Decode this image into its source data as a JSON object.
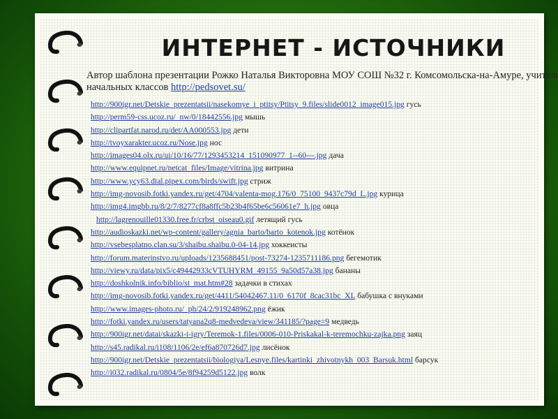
{
  "title": "ИНТЕРНЕТ - ИСТОЧНИКИ",
  "author": {
    "text": "Автор шаблона презентации Рожко Наталья Викторовна МОУ СОШ №32 г. Комсомольска-на-Амуре, учитель начальных классов",
    "link": "http://pedsovet.su/"
  },
  "sources": [
    {
      "url": "http://900igr.net/Detskie_prezentatsii/nasekomye_i_ptitsy/Ptitsy_9.files/slide0012_image015.jpg",
      "label": "гусь"
    },
    {
      "url": "http://perm59-css.ucoz.ru/_nw/0/18442556.jpg",
      "label": "мышь"
    },
    {
      "url": "http://clipartfat.narod.ru/det/AA000553.jpg",
      "label": "дети"
    },
    {
      "url": "http://tvoyxarakter.ucoz.ru/Nose.jpg",
      "label": "нос"
    },
    {
      "url": "http://images04.olx.ru/ui/10/16/77/1293453214_151090977_1--60---.jpg",
      "label": "дача"
    },
    {
      "url": "http://www.equipnet.ru/netcat_files/Image/vitrina.jpg",
      "label": "витрина"
    },
    {
      "url": "http://www.ycy63.dial.pipex.com/birds/swift.jpg",
      "label": "стриж"
    },
    {
      "url": "http://img-novosib.fotki.yandex.ru/get/4704/valenta-mog.176/0_75100_9437c79d_L.jpg",
      "label": "курица"
    },
    {
      "url": "http://img4.imgbb.ru/8/2/7/8277cf8a8ffc5b23b4f65be6c56061e7_h.jpg",
      "label": "овца"
    },
    {
      "url": "http://lagrenouille01330.free.fr/crbst_oiseau0.gif",
      "label": "летящий гусь"
    },
    {
      "url": "http://audioskazki.net/wp-content/gallery/agnia_barto/barto_kotenok.jpg",
      "label": "котёнок"
    },
    {
      "url": "http://vsebesplatno.clan.su/3/shaibu.shaibu.0-04-14.jpg",
      "label": "хоккеисты"
    },
    {
      "url": "http://forum.materinstvo.ru/uploads/1235688451/post-73274-1235711186.png",
      "label": "бегемотик"
    },
    {
      "url": "http://viewy.ru/data/pix5/c49442933cVTUHYRM_49155_9a50d57a38.jpg",
      "label": "бананы"
    },
    {
      "url": "http://doshkolnik.info/biblio/st_mat.htm#28",
      "label": "задачки в стихах"
    },
    {
      "url": "http://img-novosib.fotki.yandex.ru/get/4411/54042467.11/0_6170f_8cac31bc_XL",
      "label": "бабушка с внуками"
    },
    {
      "url": "http://www.images-photo.ru/_ph/24/2/919248962.png",
      "label": "ёжик"
    },
    {
      "url": "http://fotki.yandex.ru/users/tatyana2q8-medvedeva/view/341185/?page=9",
      "label": "медведь"
    },
    {
      "url": "http://900igr.net/datai/skazki-i-igry/Teremok-1.files/0006-010-Priskakal-k-teremochku-zajka.png",
      "label": "заяц"
    },
    {
      "url": "http://s45.radikal.ru/i108/1106/2e/ef6a870726d7.jpg",
      "label": "лисёнок"
    },
    {
      "url": "http://900igr.net/Detskie_prezentatsii/biologiya/Lesnye.files/kartinki_zhivotnykh_003_Barsuk.html",
      "label": "барсук"
    },
    {
      "url": "http://i032.radikal.ru/0804/5e/8f94259d5122.jpg",
      "label": "волк"
    }
  ]
}
